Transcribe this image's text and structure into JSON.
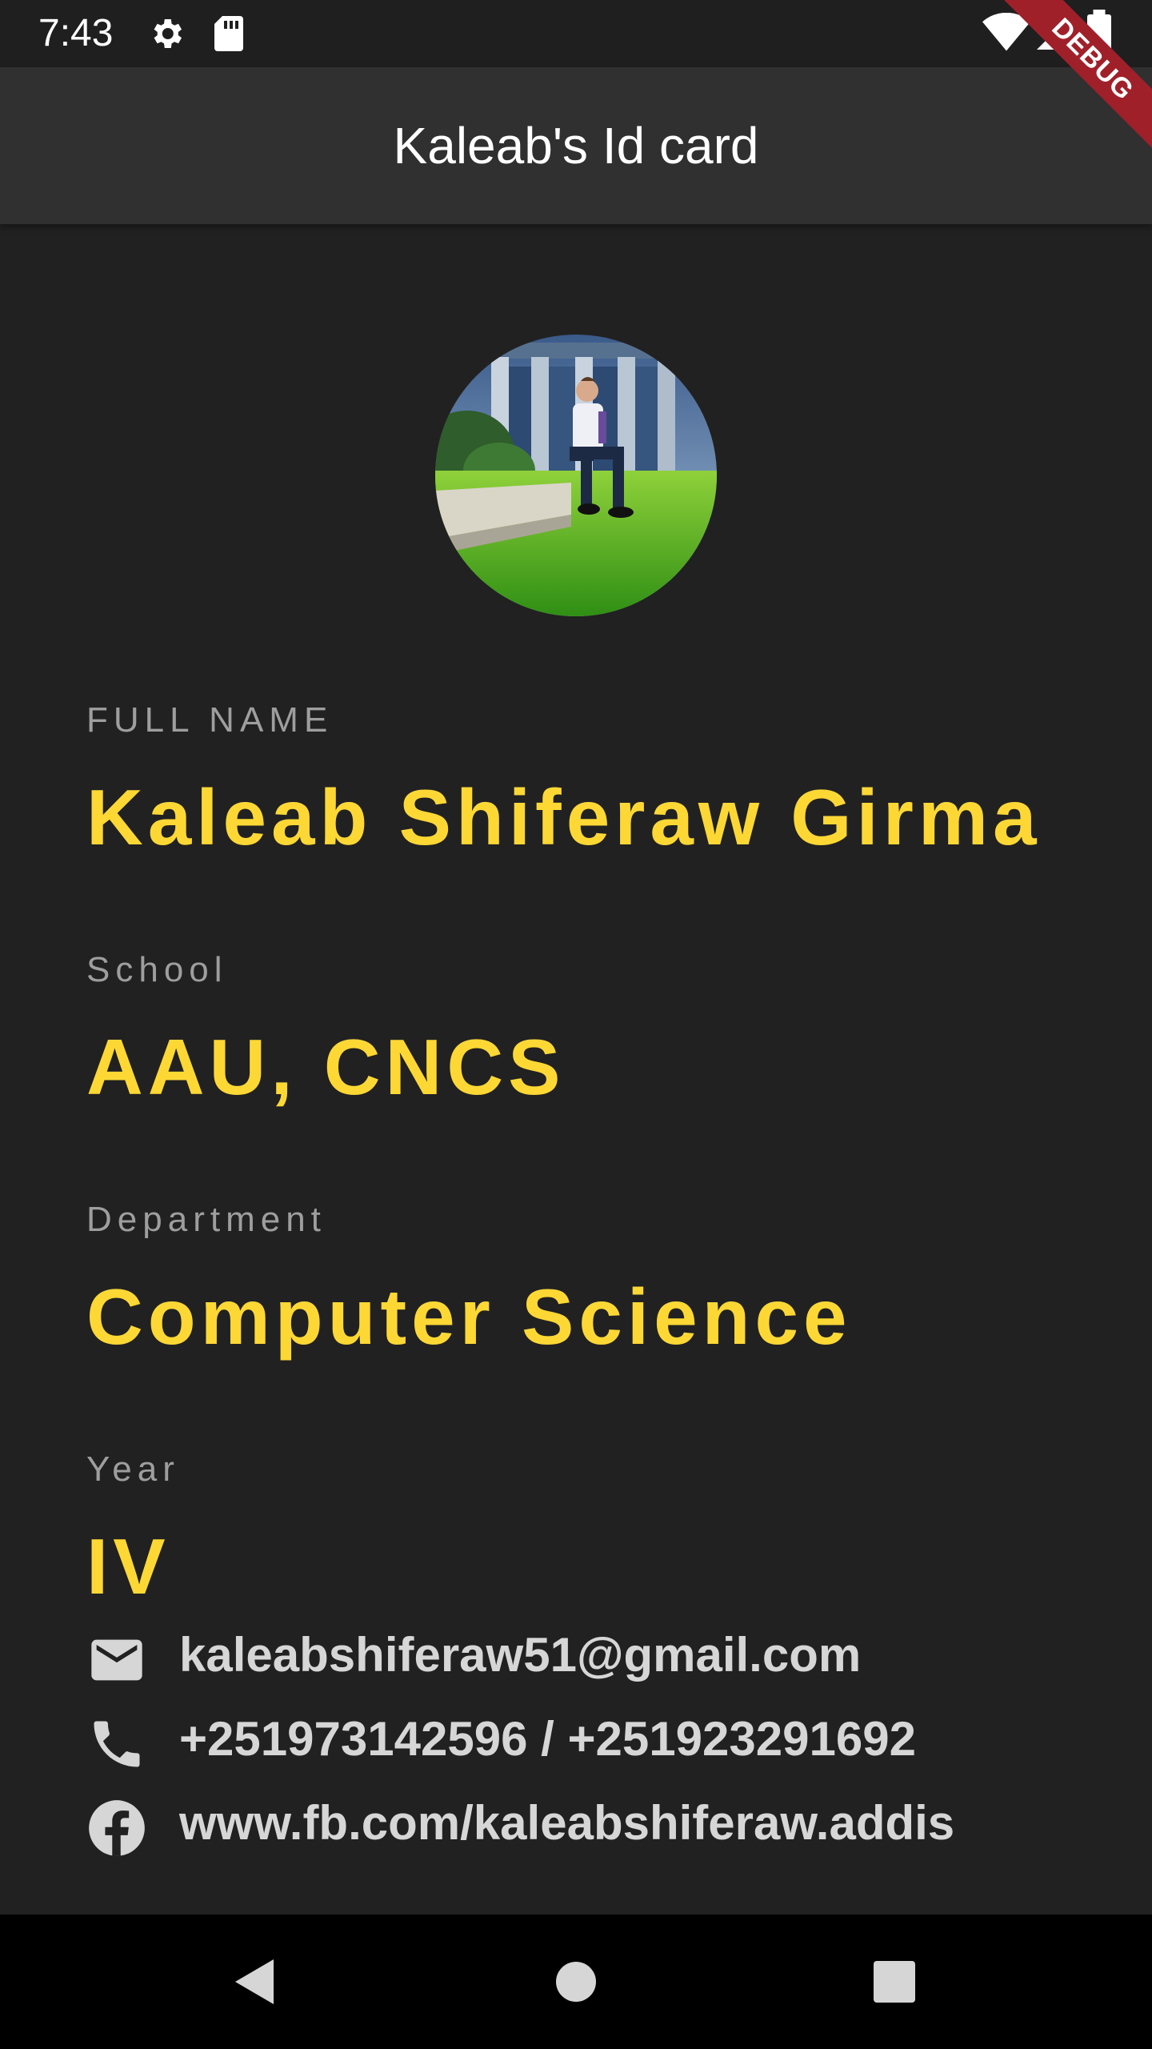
{
  "status_bar": {
    "time": "7:43",
    "left_icons": [
      "gear-icon",
      "sd-card-icon"
    ],
    "right_icons": [
      "wifi-icon",
      "cell-signal-icon",
      "battery-icon"
    ]
  },
  "app_bar": {
    "title": "Kaleab's Id card"
  },
  "debug_banner": {
    "label": "DEBUG",
    "color": "#a0202a"
  },
  "profile": {
    "avatar": "profile-photo"
  },
  "fields": [
    {
      "label": "FULL NAME",
      "value": "Kaleab Shiferaw Girma"
    },
    {
      "label": "School",
      "value": "AAU, CNCS"
    },
    {
      "label": "Department",
      "value": "Computer Science"
    },
    {
      "label": "Year",
      "value": "IV"
    }
  ],
  "contacts": [
    {
      "icon": "email-icon",
      "text": "kaleabshiferaw51@gmail.com"
    },
    {
      "icon": "phone-icon",
      "text": "+251973142596 / +251923291692"
    },
    {
      "icon": "facebook-icon",
      "text": "www.fb.com/kaleabshiferaw.addis"
    }
  ],
  "nav_bar": {
    "buttons": [
      "back-button",
      "home-button",
      "recents-button"
    ]
  },
  "colors": {
    "background": "#212121",
    "app_bar": "#303030",
    "accent": "#fdd835",
    "label": "#9e9e9e",
    "contact_text": "#d6d6d6"
  }
}
